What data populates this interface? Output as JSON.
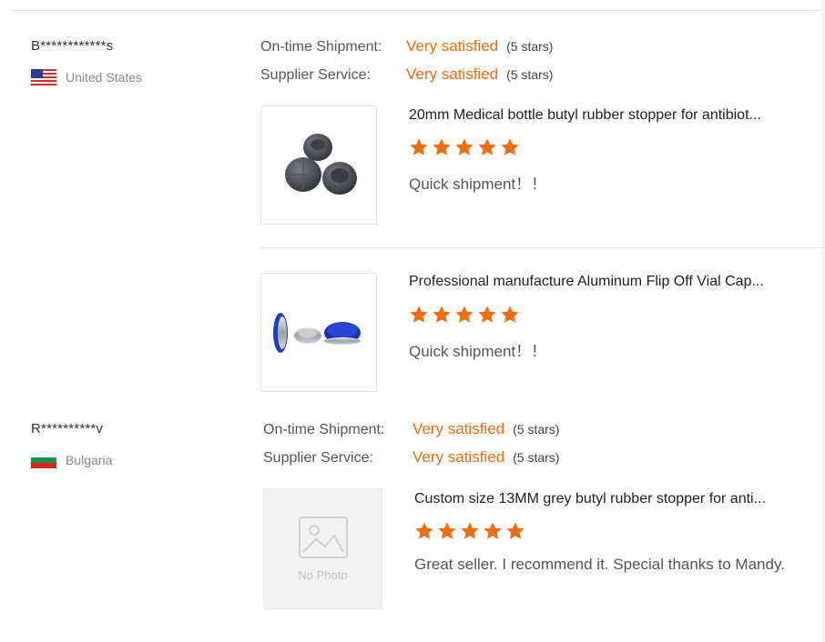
{
  "reviews": [
    {
      "reviewer": "B************s",
      "country": "United States",
      "flag_icon": "us-flag-icon",
      "ratings": {
        "shipment_label": "On-time Shipment:",
        "shipment_value": "Very satisfied",
        "shipment_stars": "(5 stars)",
        "service_label": "Supplier Service:",
        "service_value": "Very satisfied",
        "service_stars": "(5 stars)"
      },
      "products": [
        {
          "title": "20mm Medical bottle butyl rubber stopper for antibiot...",
          "rating": 5,
          "comment": "Quick shipment！！",
          "image": "grey-rubber-stoppers-image"
        },
        {
          "title": "Professional manufacture Aluminum Flip Off Vial Cap...",
          "rating": 5,
          "comment": "Quick shipment！！",
          "image": "blue-flip-off-caps-image"
        }
      ]
    },
    {
      "reviewer": "R**********v",
      "country": "Bulgaria",
      "flag_icon": "bulgaria-flag-icon",
      "ratings": {
        "shipment_label": "On-time Shipment:",
        "shipment_value": "Very satisfied",
        "shipment_stars": "(5 stars)",
        "service_label": "Supplier Service:",
        "service_value": "Very satisfied",
        "service_stars": "(5 stars)"
      },
      "products": [
        {
          "title": "Custom size 13MM grey butyl rubber stopper for anti...",
          "rating": 5,
          "comment": "Great seller.  I recommend it.  Special thanks to Mandy.",
          "image_placeholder": "No Photo"
        }
      ]
    }
  ],
  "colors": {
    "accent": "#f26c10",
    "star": "#f26c10",
    "divider": "#e3e3e3"
  }
}
